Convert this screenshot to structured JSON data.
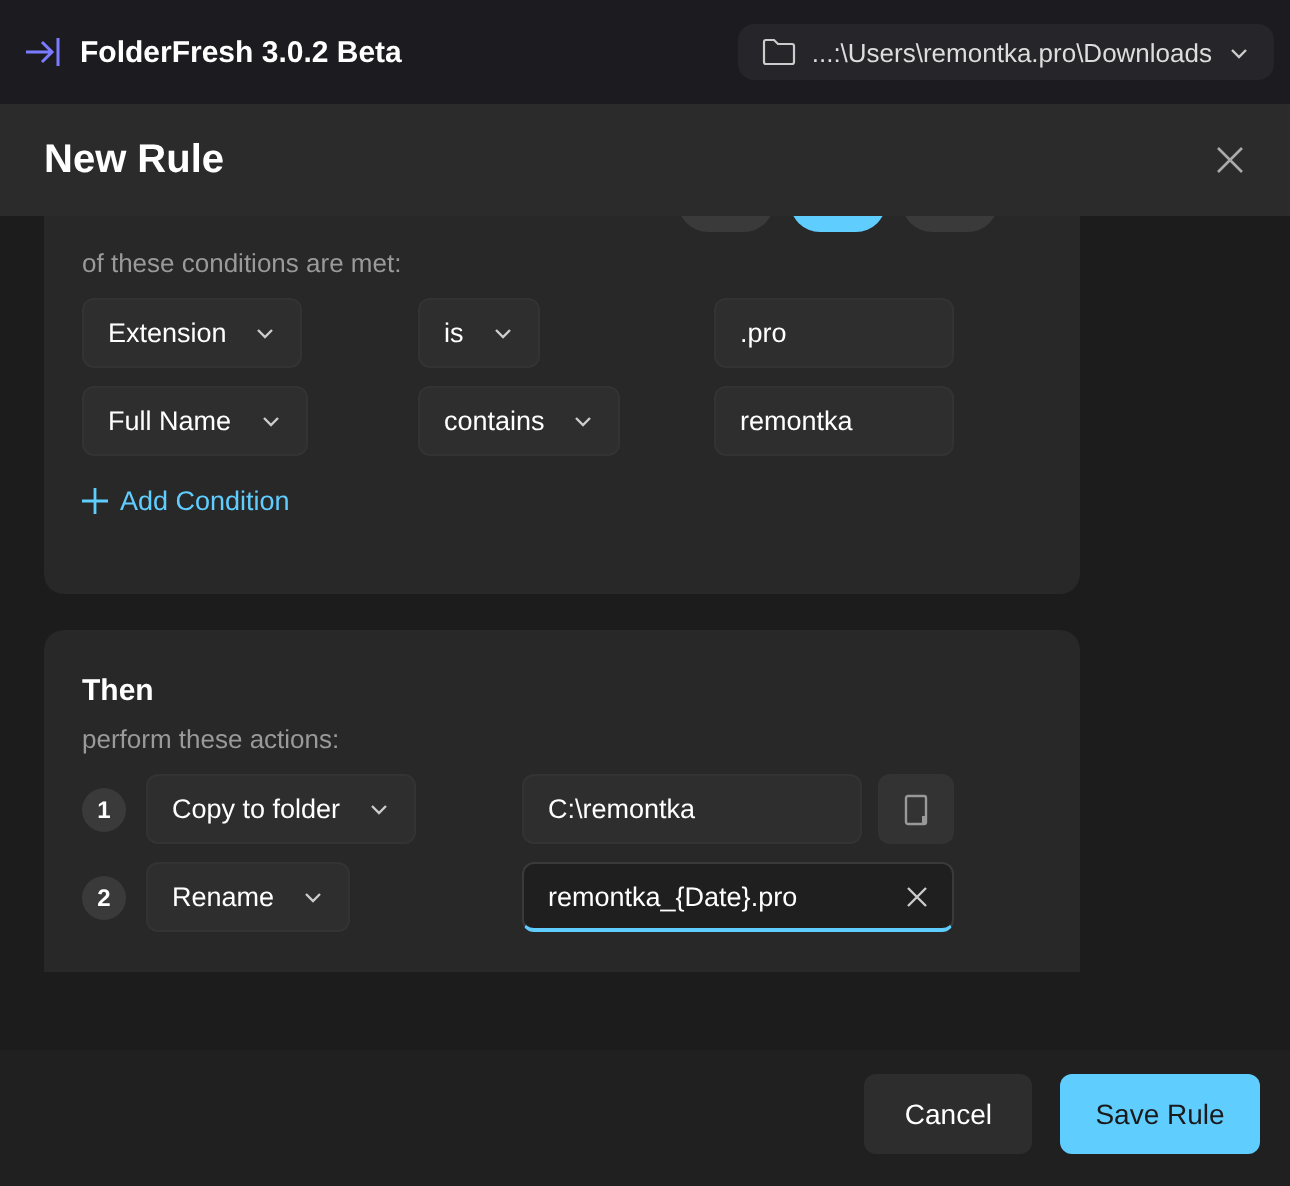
{
  "app": {
    "title": "FolderFresh 3.0.2 Beta",
    "folder_path": "...:\\Users\\remontka.pro\\Downloads"
  },
  "dialog": {
    "title": "New Rule"
  },
  "conditions": {
    "match_options": [
      {
        "selected": false
      },
      {
        "selected": true
      },
      {
        "selected": false
      }
    ],
    "caption": "of these conditions are met:",
    "rows": [
      {
        "field": "Extension",
        "operator": "is",
        "value": ".pro"
      },
      {
        "field": "Full Name",
        "operator": "contains",
        "value": "remontka"
      }
    ],
    "add_label": "Add Condition"
  },
  "actions": {
    "heading": "Then",
    "caption": "perform these actions:",
    "rows": [
      {
        "number": "1",
        "action": "Copy to folder",
        "value": "C:\\remontka",
        "kind": "folder",
        "focused": false
      },
      {
        "number": "2",
        "action": "Rename",
        "value": "remontka_{Date}.pro",
        "kind": "text",
        "focused": true
      }
    ]
  },
  "buttons": [
    {
      "label": "Cancel",
      "primary": false
    },
    {
      "label": "Save Rule",
      "primary": true
    }
  ]
}
